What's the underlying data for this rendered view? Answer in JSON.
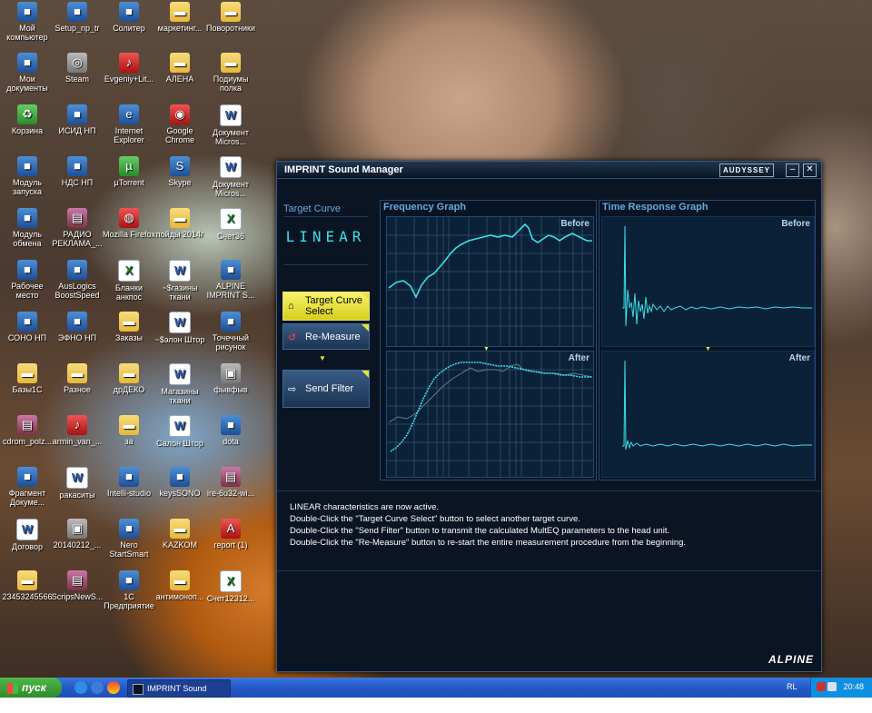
{
  "desktop": {
    "icons": [
      {
        "label": "Мой компьютер",
        "glyph": "computer-icon"
      },
      {
        "label": "Setup_np_tr",
        "glyph": "setup-icon"
      },
      {
        "label": "Солитер",
        "glyph": "solitaire-icon"
      },
      {
        "label": "маркетинг...",
        "glyph": "folder-icon"
      },
      {
        "label": "Поворотники",
        "glyph": "folder-icon"
      },
      {
        "label": "Мои документы",
        "glyph": "my-documents-icon"
      },
      {
        "label": "Steam",
        "glyph": "steam-icon"
      },
      {
        "label": "Evgeniy+Lit...",
        "glyph": "mp3-icon"
      },
      {
        "label": "АЛЕНА",
        "glyph": "folder-icon"
      },
      {
        "label": "Подиумы полка",
        "glyph": "folder-icon"
      },
      {
        "label": "Корзина",
        "glyph": "recycle-bin-icon"
      },
      {
        "label": "ИСИД НП",
        "glyph": "app-icon"
      },
      {
        "label": "Internet Explorer",
        "glyph": "ie-icon"
      },
      {
        "label": "Google Chrome",
        "glyph": "chrome-icon"
      },
      {
        "label": "Документ Micros...",
        "glyph": "word-doc-icon"
      },
      {
        "label": "Модуль запуска",
        "glyph": "launcher-icon"
      },
      {
        "label": "НДС НП",
        "glyph": "app-icon"
      },
      {
        "label": "µTorrent",
        "glyph": "utorrent-icon"
      },
      {
        "label": "Skype",
        "glyph": "skype-icon"
      },
      {
        "label": "Документ Micros...",
        "glyph": "word-doc-icon"
      },
      {
        "label": "Модуль обмена",
        "glyph": "exchange-icon"
      },
      {
        "label": "РАДИО РЕКЛАМА_...",
        "glyph": "winrar-icon"
      },
      {
        "label": "Mozilla Firefox",
        "glyph": "firefox-icon"
      },
      {
        "label": "пойды 2014г",
        "glyph": "folder-icon"
      },
      {
        "label": "Счет36",
        "glyph": "excel-doc-icon"
      },
      {
        "label": "Рабочее место",
        "glyph": "workplace-icon"
      },
      {
        "label": "AusLogics BoostSpeed",
        "glyph": "auslogics-icon"
      },
      {
        "label": "Бланки анкпос",
        "glyph": "excel-doc-icon"
      },
      {
        "label": "~$газины ткани",
        "glyph": "word-doc-icon"
      },
      {
        "label": "ALPINE IMPRINT S...",
        "glyph": "alpine-icon"
      },
      {
        "label": "СОНО НП",
        "glyph": "app-icon"
      },
      {
        "label": "ЭФНО НП",
        "glyph": "app-icon"
      },
      {
        "label": "Заказы",
        "glyph": "folder-icon"
      },
      {
        "label": "~$элон Штор",
        "glyph": "word-doc-icon"
      },
      {
        "label": "Точечный рисунок",
        "glyph": "paint-icon"
      },
      {
        "label": "Базы1С",
        "glyph": "folder-icon"
      },
      {
        "label": "Разное",
        "glyph": "folder-icon"
      },
      {
        "label": "дрДЕКО",
        "glyph": "folder-icon"
      },
      {
        "label": "Магазины ткани",
        "glyph": "word-doc-icon"
      },
      {
        "label": "фывфыв",
        "glyph": "image-icon"
      },
      {
        "label": "cdrom_polz...",
        "glyph": "winrar-icon"
      },
      {
        "label": "armin_van_...",
        "glyph": "mp3-icon"
      },
      {
        "label": "за",
        "glyph": "folder-icon"
      },
      {
        "label": "Салон Штор",
        "glyph": "word-doc-icon"
      },
      {
        "label": "dota",
        "glyph": "dota-icon"
      },
      {
        "label": "Фрагмент Докуме...",
        "glyph": "fragment-icon"
      },
      {
        "label": "ракаситы",
        "glyph": "word-doc-icon"
      },
      {
        "label": "Intelli-studio",
        "glyph": "intelli-icon"
      },
      {
        "label": "keysSONO",
        "glyph": "keys-icon"
      },
      {
        "label": "ire-6u32-wi...",
        "glyph": "winrar-icon"
      },
      {
        "label": "Договор",
        "glyph": "word-doc-icon"
      },
      {
        "label": "20140212_...",
        "glyph": "image-icon"
      },
      {
        "label": "Nero StartSmart",
        "glyph": "nero-icon"
      },
      {
        "label": "KAZKOM",
        "glyph": "folder-icon"
      },
      {
        "label": "report (1)",
        "glyph": "pdf-icon"
      },
      {
        "label": "23453245566",
        "glyph": "folder-icon"
      },
      {
        "label": "ScripsNewS...",
        "glyph": "winrar-icon"
      },
      {
        "label": "1С Предприятие",
        "glyph": "1c-icon"
      },
      {
        "label": "антимоноп...",
        "glyph": "folder-icon"
      },
      {
        "label": "Счет12312...",
        "glyph": "excel-doc-icon"
      }
    ]
  },
  "window": {
    "title": "IMPRINT Sound Manager",
    "badge": "AUDYSSEY",
    "minimize_label": "–",
    "close_label": "✕",
    "target_curve": {
      "label": "Target Curve",
      "value": "LINEAR"
    },
    "buttons": {
      "target_curve_select": "Target Curve Select",
      "re_measure": "Re-Measure",
      "send_filter": "Send Filter"
    },
    "frequency_graph": {
      "title": "Frequency Graph",
      "before": "Before",
      "after": "After"
    },
    "time_graph": {
      "title": "Time Response Graph",
      "before": "Before",
      "after": "After"
    },
    "messages": [
      "LINEAR characteristics are now active.",
      "Double-Click the \"Target Curve Select\" button to select another target curve.",
      "Double-Click the \"Send Filter\" button to transmit the calculated MultEQ parameters to the head unit.",
      "Double-Click the \"Re-Measure\" button to re-start the entire measurement procedure from the beginning."
    ],
    "brand": "ALPINE"
  },
  "taskbar": {
    "start_label": "пуск",
    "task_label": "IMPRINT Sound Mana...",
    "language": "RL",
    "clock": "20:48"
  },
  "colors": {
    "accent_cyan": "#38e0e8",
    "button_yellow": "#f0ec4a",
    "window_bg": "#0b1422",
    "taskbar_blue": "#2459c8"
  }
}
